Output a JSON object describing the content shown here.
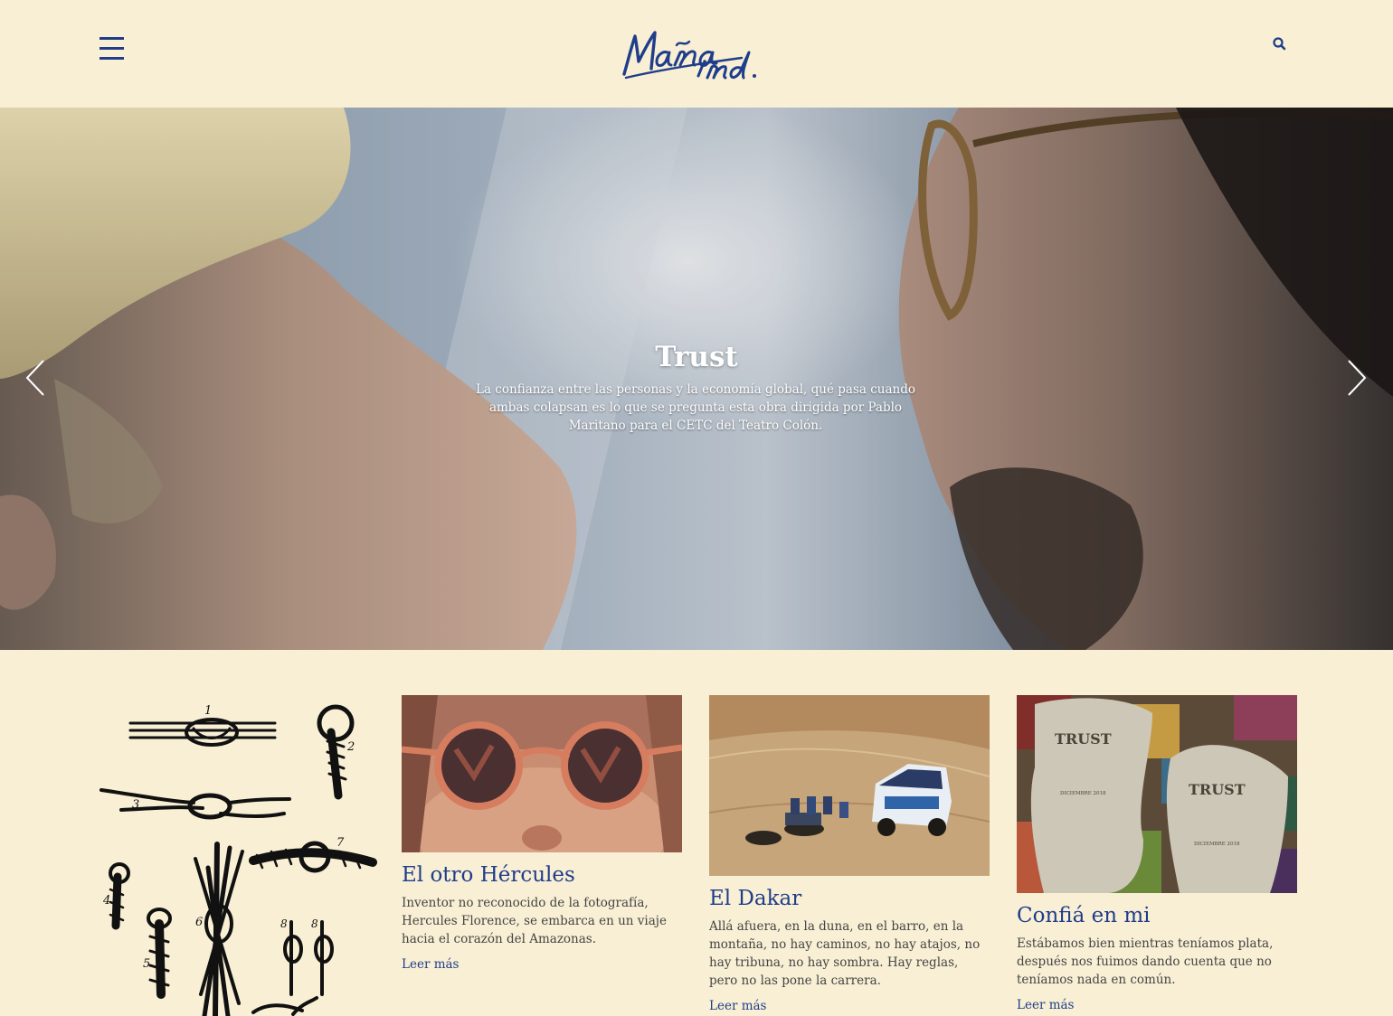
{
  "header": {
    "menu_icon": "hamburger-menu-icon",
    "logo_text_line1": "Maña",
    "logo_text_line2": "ind.",
    "search_icon": "search-icon"
  },
  "hero": {
    "title": "Trust",
    "description": "La confianza entre las personas y la economía global, qué pasa cuando ambas colapsan es lo que se pregunta esta obra dirigida por Pablo Maritano para el CETC del Teatro Colón.",
    "prev_icon": "chevron-left-icon",
    "next_icon": "chevron-right-icon"
  },
  "cards": [
    {
      "title": "El otro Hércules",
      "excerpt": "Inventor no reconocido de la fotografía, Hercules Florence, se embarca en un viaje hacia el corazón del Amazonas.",
      "link": "Leer más"
    },
    {
      "title": "El Dakar",
      "excerpt": "Allá afuera, en la duna, en el barro, en la montaña, no hay caminos, no hay atajos, no hay tribuna, no hay sombra. Hay reglas, pero no las pone la carrera.",
      "link": "Leer más"
    },
    {
      "title": "Confiá en mi",
      "excerpt": "Estábamos bien mientras teníamos plata, después nos fuimos dando cuenta que no teníamos nada en común.",
      "link": "Leer más",
      "poster_title": "TRUST",
      "poster_date": "DICIEMBRE 2018"
    }
  ],
  "colors": {
    "background": "#f8efd4",
    "brand_blue": "#1f3d8a"
  }
}
